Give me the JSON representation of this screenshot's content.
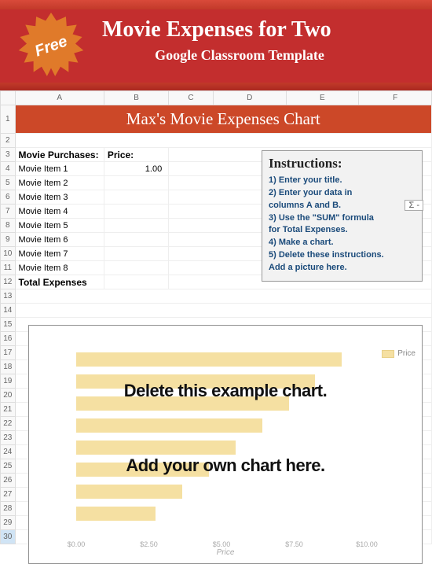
{
  "banner": {
    "badge": "Free",
    "title": "Movie Expenses for Two",
    "subtitle": "Google Classroom Template"
  },
  "sheet": {
    "columns": [
      "A",
      "B",
      "C",
      "D",
      "E",
      "F"
    ],
    "title": "Max's Movie  Expenses  Chart",
    "headers": {
      "purchases": "Movie Purchases:",
      "price": "Price:"
    },
    "items": [
      {
        "label": "Movie Item 1",
        "price": "1.00"
      },
      {
        "label": "Movie Item 2",
        "price": ""
      },
      {
        "label": "Movie Item 3",
        "price": ""
      },
      {
        "label": "Movie Item 4",
        "price": ""
      },
      {
        "label": "Movie Item 5",
        "price": ""
      },
      {
        "label": "Movie Item 6",
        "price": ""
      },
      {
        "label": "Movie Item 7",
        "price": ""
      },
      {
        "label": "Movie Item 8",
        "price": ""
      }
    ],
    "total_label": "Total Expenses",
    "row_numbers_extra": [
      "13",
      "14",
      "15",
      "16",
      "17",
      "18",
      "19",
      "20",
      "21",
      "22",
      "23",
      "24",
      "25",
      "26",
      "27",
      "28",
      "29",
      "30"
    ],
    "selected_row": "30"
  },
  "instructions": {
    "title": "Instructions:",
    "lines": [
      "1) Enter your title.",
      "2) Enter your data in",
      "    columns A and B.",
      "3) Use the \"SUM\" formula",
      "    for Total Expenses.",
      "4) Make a chart.",
      "5) Delete these instructions.",
      "    Add a picture here."
    ],
    "sigma": "Σ  -"
  },
  "chart_data": {
    "type": "bar",
    "orientation": "horizontal",
    "series": [
      {
        "name": "Price",
        "values": [
          10.0,
          9.0,
          8.0,
          7.0,
          6.0,
          5.0,
          4.0,
          3.0
        ]
      }
    ],
    "xlabel": "Price",
    "xticks": [
      "$0.00",
      "$2.50",
      "$5.00",
      "$7.50",
      "$10.00"
    ],
    "xlim": [
      0,
      11
    ],
    "overlay_texts": [
      "Delete this example chart.",
      "Add your own chart here."
    ],
    "legend_position": "right",
    "bar_color": "#f5e0a2"
  }
}
